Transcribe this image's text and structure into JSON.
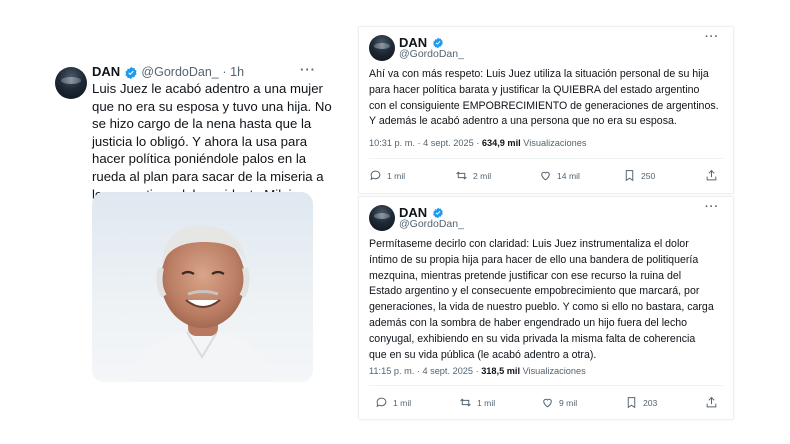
{
  "left_tweet": {
    "name": "DAN",
    "handle": "@GordoDan_",
    "separator": "·",
    "time": "1h",
    "more": "···",
    "text_lines": [
      "Luis Juez le acabó adentro a una mujer",
      "que no era su esposa y tuvo una hija. No",
      "se hizo cargo de la nena hasta que la",
      "justicia lo obligó. Y ahora la usa para",
      "hacer política poniéndole palos en la",
      "rueda al plan para sacar de la miseria a",
      "los argentinos del presidente Milei."
    ]
  },
  "card1": {
    "name": "DAN",
    "handle": "@GordoDan_",
    "more": "···",
    "text_lines": [
      "Ahí va con más respeto: Luis Juez utiliza la situación personal de su hija",
      "para hacer política barata y justificar la QUIEBRA del estado argentino",
      "con el consiguiente EMPOBRECIMIENTO de generaciones de argentinos.",
      "Y además le acabó adentro a una persona que no era su esposa."
    ],
    "time": "10:31 p. m. · 4 sept. 2025 · ",
    "views": "634,9 mil",
    "views_label": " Visualizaciones",
    "replies": "1 mil",
    "reposts": "2 mil",
    "likes": "14 mil",
    "bookmarks": "250"
  },
  "card2": {
    "name": "DAN",
    "handle": "@GordoDan_",
    "more": "···",
    "text_lines": [
      "Permítaseme decirlo con claridad: Luis Juez instrumentaliza el dolor",
      "íntimo de su propia hija para hacer de ello una bandera de politiquería",
      "mezquina, mientras pretende justificar con ese recurso la ruina del",
      "Estado argentino y el consecuente empobrecimiento que marcará, por",
      "generaciones, la vida de nuestro pueblo. Y como si ello no bastara, carga",
      "además con la sombra de haber engendrado un hijo fuera del lecho",
      "conyugal, exhibiendo en su vida privada la misma falta de coherencia",
      "que en su vida pública (le acabó adentro a otra)."
    ],
    "time": "11:15 p. m. · 4 sept. 2025 · ",
    "views": "318,5 mil",
    "views_label": " Visualizaciones",
    "replies": "1 mil",
    "reposts": "1 mil",
    "likes": "9 mil",
    "bookmarks": "203"
  },
  "colors": {
    "verified": "#1d9bf0",
    "text": "#0f1419",
    "muted": "#536471"
  }
}
